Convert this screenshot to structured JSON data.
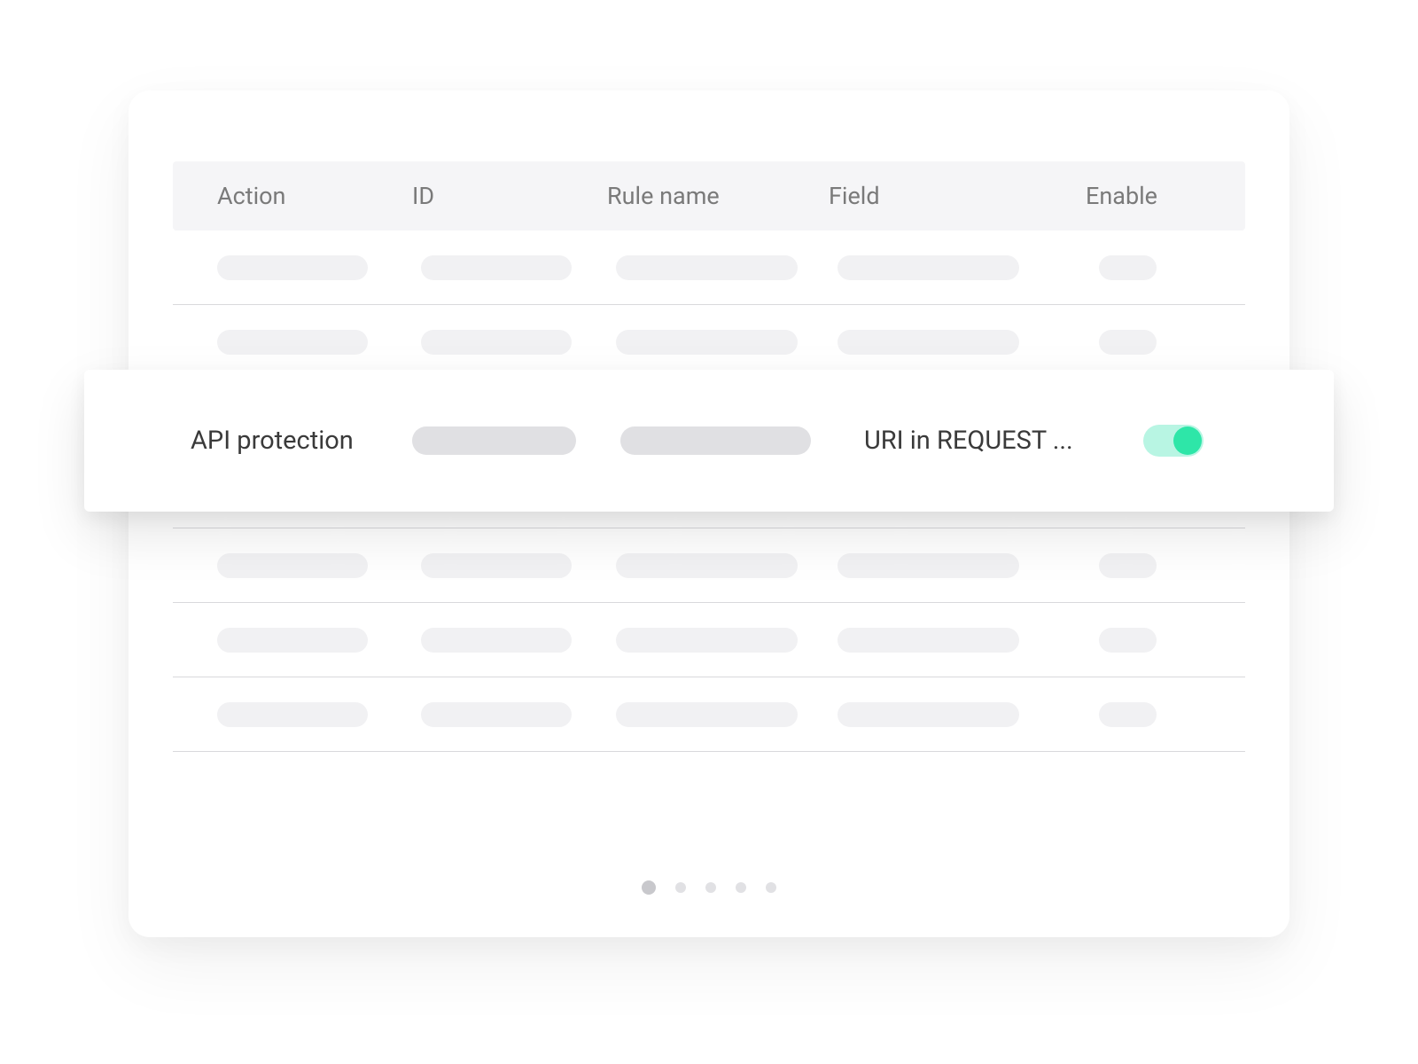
{
  "table": {
    "headers": {
      "action": "Action",
      "id": "ID",
      "rule_name": "Rule name",
      "field": "Field",
      "enable": "Enable"
    },
    "placeholder_row_count": 7
  },
  "highlighted_row": {
    "action": "API protection",
    "field": "URI in REQUEST ...",
    "enabled": true
  },
  "pagination": {
    "pages": 5,
    "active_index": 0
  },
  "colors": {
    "toggle_track": "#b8f5e3",
    "toggle_knob": "#2ee6a8",
    "skeleton": "#f1f1f3",
    "skeleton_dark": "#e0e0e3",
    "header_bg": "#f5f5f7",
    "text_muted": "#7a7a7a",
    "text": "#3a3a3a"
  }
}
